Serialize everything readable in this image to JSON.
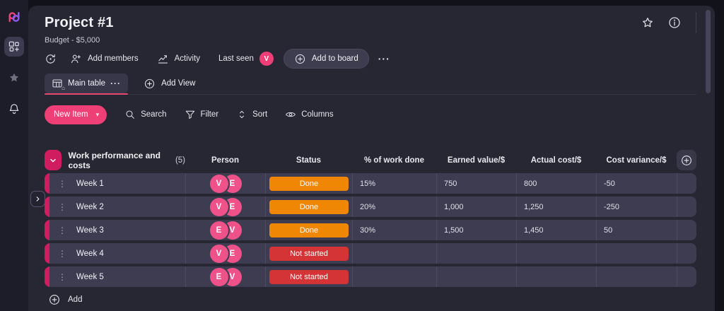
{
  "header": {
    "title": "Project #1",
    "subtitle": "Budget - $5,000"
  },
  "toolbar": {
    "add_members": "Add members",
    "activity": "Activity",
    "last_seen": "Last seen",
    "last_seen_avatar": "V",
    "add_to_board": "Add to board"
  },
  "tabs": {
    "main_table": "Main table",
    "add_view": "Add View"
  },
  "actions": {
    "new_item": "New Item",
    "search": "Search",
    "filter": "Filter",
    "sort": "Sort",
    "columns": "Columns"
  },
  "table": {
    "group_title": "Work performance and costs",
    "group_count": "(5)",
    "columns": {
      "person": "Person",
      "status": "Status",
      "pct": "% of work done",
      "earned": "Earned value/$",
      "actual": "Actual cost/$",
      "variance": "Cost variance/$"
    },
    "rows": [
      {
        "name": "Week 1",
        "avatars": [
          "V",
          "E"
        ],
        "status": "Done",
        "status_class": "badge-done",
        "pct": "15%",
        "earned": "750",
        "actual": "800",
        "variance": "-50"
      },
      {
        "name": "Week 2",
        "avatars": [
          "V",
          "E"
        ],
        "status": "Done",
        "status_class": "badge-done",
        "pct": "20%",
        "earned": "1,000",
        "actual": "1,250",
        "variance": "-250"
      },
      {
        "name": "Week 3",
        "avatars": [
          "E",
          "V"
        ],
        "status": "Done",
        "status_class": "badge-done",
        "pct": "30%",
        "earned": "1,500",
        "actual": "1,450",
        "variance": "50"
      },
      {
        "name": "Week 4",
        "avatars": [
          "V",
          "E"
        ],
        "status": "Not started",
        "status_class": "badge-notstarted",
        "pct": "",
        "earned": "",
        "actual": "",
        "variance": ""
      },
      {
        "name": "Week 5",
        "avatars": [
          "E",
          "V"
        ],
        "status": "Not started",
        "status_class": "badge-notstarted",
        "pct": "",
        "earned": "",
        "actual": "",
        "variance": ""
      }
    ],
    "add_label": "Add"
  },
  "icons": {
    "more_horizontal": "···",
    "kebab": "⋮",
    "caret_down": "▾",
    "home_badge": "⌂"
  },
  "colors": {
    "accent_pink": "#ee4077",
    "group_pink": "#cf1d60",
    "avatar_pink": "#ef5289",
    "done_orange": "#ef8705",
    "not_started_red": "#d43435",
    "panel_bg": "#272633",
    "row_bg": "#3d3c51"
  }
}
